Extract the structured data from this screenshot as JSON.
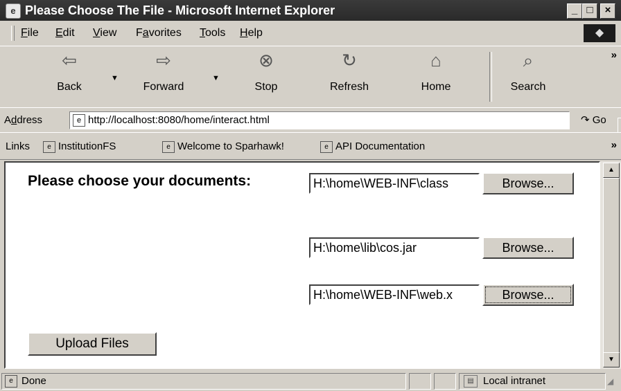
{
  "window": {
    "title": "Please Choose The File - Microsoft Internet Explorer"
  },
  "menu": [
    "File",
    "Edit",
    "View",
    "Favorites",
    "Tools",
    "Help"
  ],
  "menu_keys": [
    "F",
    "E",
    "V",
    "a",
    "T",
    "H"
  ],
  "toolbar": {
    "back": "Back",
    "forward": "Forward",
    "stop": "Stop",
    "refresh": "Refresh",
    "home": "Home",
    "search": "Search",
    "more": "»"
  },
  "address": {
    "label": "Address",
    "label_key": "d",
    "url": "http://localhost:8080/home/interact.html",
    "go": "Go"
  },
  "links": {
    "label": "Links",
    "items": [
      "InstitutionFS",
      "Welcome to Sparhawk!",
      "API Documentation"
    ],
    "more": "»"
  },
  "form": {
    "heading": "Please choose your documents:",
    "files": [
      {
        "value": "H:\\home\\WEB-INF\\class",
        "button": "Browse..."
      },
      {
        "value": "H:\\home\\lib\\cos.jar",
        "button": "Browse..."
      },
      {
        "value": "H:\\home\\WEB-INF\\web.x",
        "button": "Browse..."
      }
    ],
    "submit": "Upload Files"
  },
  "status": {
    "text": "Done",
    "zone": "Local intranet"
  }
}
